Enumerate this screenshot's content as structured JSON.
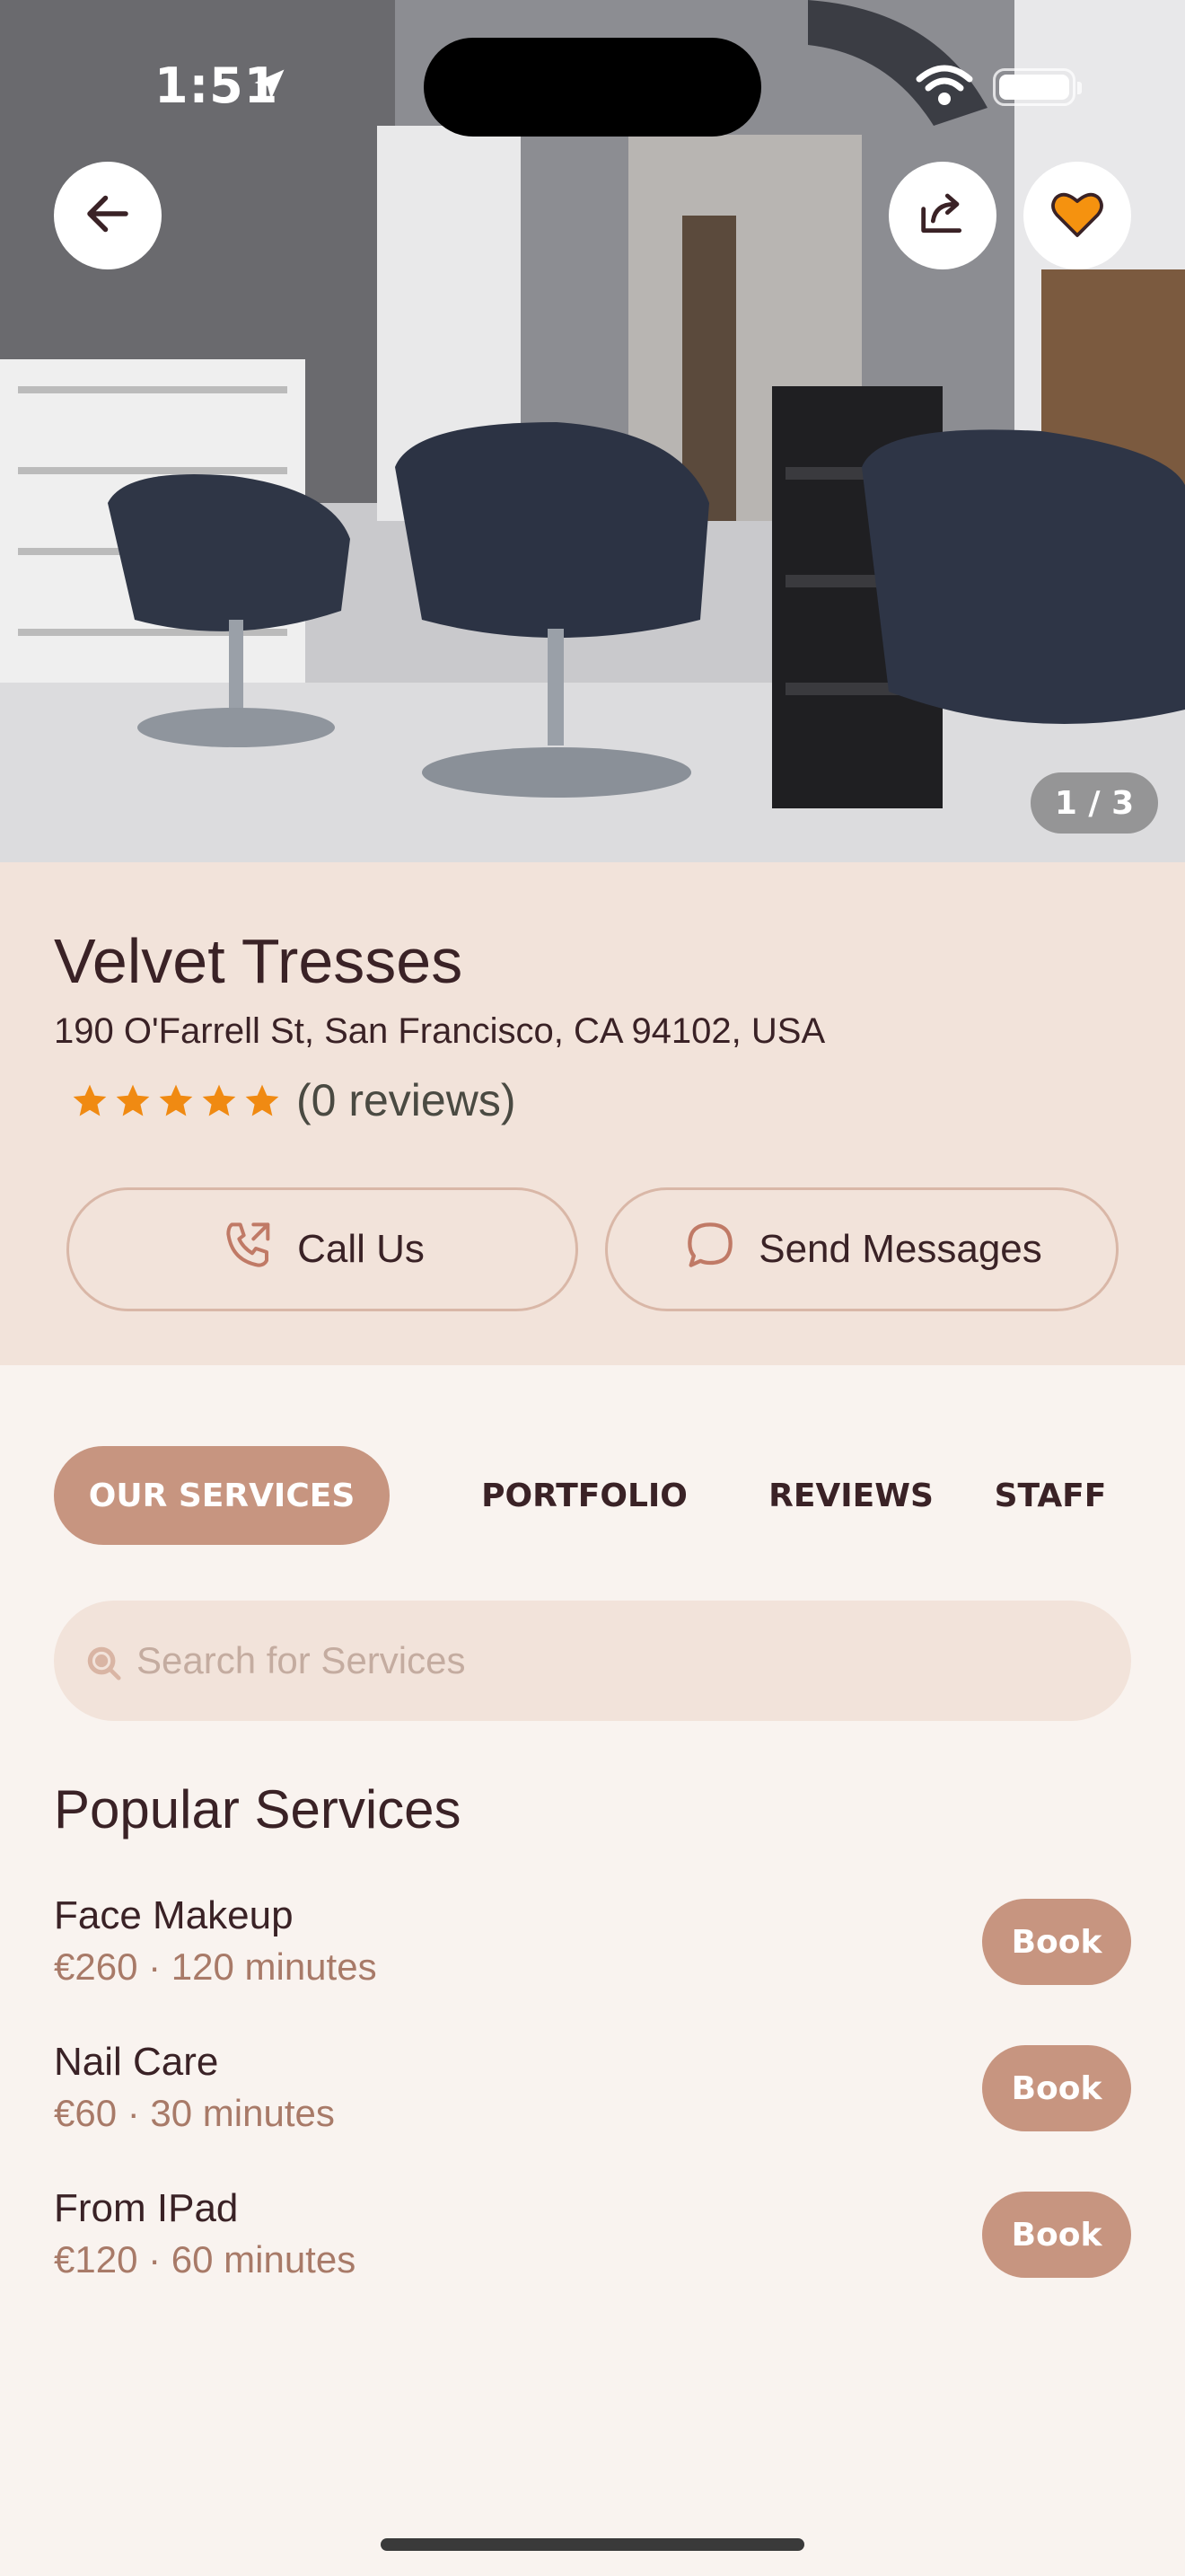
{
  "status_bar": {
    "time": "1:51"
  },
  "hero": {
    "image_counter": "1 / 3"
  },
  "salon": {
    "name": "Velvet Tresses",
    "address": "190 O'Farrell St, San Francisco, CA 94102, USA",
    "rating": 5,
    "reviews_label": "(0 reviews)"
  },
  "actions": {
    "call_label": "Call Us",
    "message_label": "Send Messages"
  },
  "tabs": [
    {
      "label": "OUR SERVICES",
      "active": true
    },
    {
      "label": "PORTFOLIO",
      "active": false
    },
    {
      "label": "REVIEWS",
      "active": false
    },
    {
      "label": "STAFF",
      "active": false
    }
  ],
  "search": {
    "placeholder": "Search for Services",
    "value": ""
  },
  "popular": {
    "title": "Popular Services",
    "items": [
      {
        "name": "Face Makeup",
        "meta": "€260 · 120 minutes",
        "button": "Book"
      },
      {
        "name": "Nail Care",
        "meta": "€60 · 30 minutes",
        "button": "Book"
      },
      {
        "name": "From IPad",
        "meta": "€120 · 60 minutes",
        "button": "Book"
      }
    ]
  },
  "colors": {
    "accent": "#c79580",
    "panel": "#f2e3da",
    "background": "#f9f3ef",
    "text": "#3a2226",
    "star": "#f08a12",
    "favorite": "#f5920f"
  },
  "icons": {
    "back": "arrow-left-icon",
    "share": "share-icon",
    "favorite": "heart-icon",
    "call": "phone-icon",
    "message": "chat-bubble-icon",
    "search": "search-icon",
    "rating": "star-icon"
  }
}
